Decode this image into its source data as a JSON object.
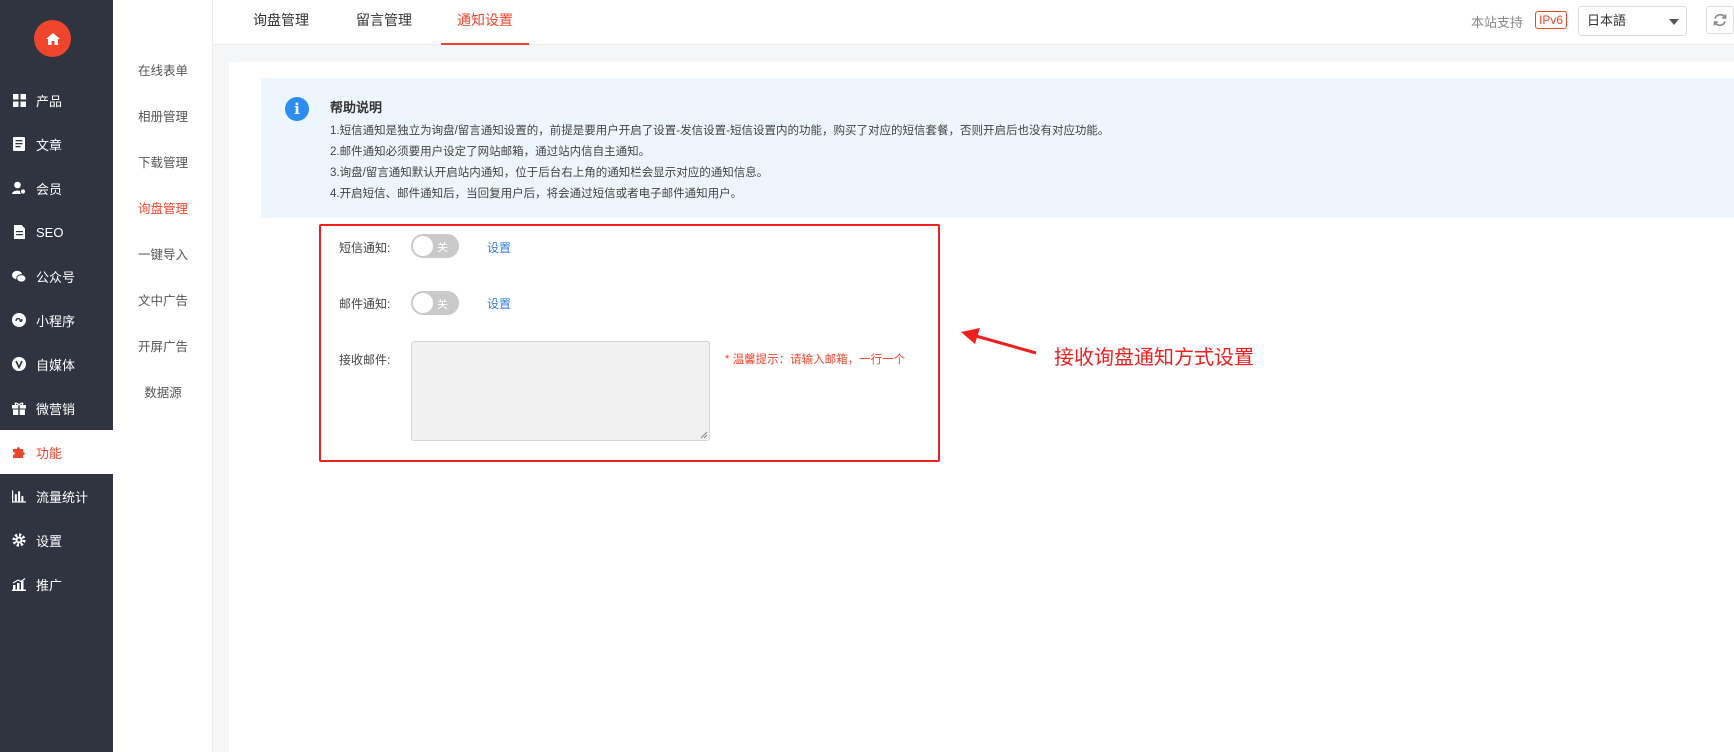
{
  "sidebar": {
    "items": [
      {
        "label": "产品",
        "icon": "grid-icon"
      },
      {
        "label": "文章",
        "icon": "document-icon"
      },
      {
        "label": "会员",
        "icon": "user-icon"
      },
      {
        "label": "SEO",
        "icon": "file-icon"
      },
      {
        "label": "公众号",
        "icon": "wechat-icon"
      },
      {
        "label": "小程序",
        "icon": "miniprogram-icon"
      },
      {
        "label": "自媒体",
        "icon": "v-media-icon"
      },
      {
        "label": "微营销",
        "icon": "gift-icon"
      },
      {
        "label": "功能",
        "icon": "puzzle-icon"
      },
      {
        "label": "流量统计",
        "icon": "bar-chart-icon"
      },
      {
        "label": "设置",
        "icon": "gear-icon"
      },
      {
        "label": "推广",
        "icon": "promote-chart-icon"
      }
    ],
    "active_label": "功能"
  },
  "submenu": {
    "items": [
      "在线表单",
      "相册管理",
      "下载管理",
      "询盘管理",
      "一键导入",
      "文中广告",
      "开屏广告",
      "数据源"
    ],
    "active": "询盘管理"
  },
  "topbar": {
    "tabs": [
      "询盘管理",
      "留言管理",
      "通知设置"
    ],
    "active_tab": "通知设置",
    "support_label": "本站支持",
    "ipv6_badge": "IPv6",
    "language": "日本語"
  },
  "help": {
    "title": "帮助说明",
    "lines": [
      "1.短信通知是独立为询盘/留言通知设置的，前提是要用户开启了设置-发信设置-短信设置内的功能，购买了对应的短信套餐，否则开启后也没有对应功能。",
      "2.邮件通知必须要用户设定了网站邮箱，通过站内信自主通知。",
      "3.询盘/留言通知默认开启站内通知，位于后台右上角的通知栏会显示对应的通知信息。",
      "4.开启短信、邮件通知后，当回复用户后，将会通过短信或者电子邮件通知用户。"
    ]
  },
  "form": {
    "sms_label": "短信通知:",
    "sms_switch_text": "关",
    "sms_link": "设置",
    "email_label": "邮件通知:",
    "email_switch_text": "关",
    "email_link": "设置",
    "receive_label": "接收邮件:",
    "receive_value": "",
    "hint": "* 温馨提示：请输入邮箱，一行一个"
  },
  "annotation": {
    "text": "接收询盘通知方式设置"
  },
  "colors": {
    "accent": "#f0452d",
    "sidebar_bg": "#2f3440",
    "link": "#3b7fd6",
    "help_bg": "#eef6fd",
    "annotation": "#f01f1f"
  }
}
